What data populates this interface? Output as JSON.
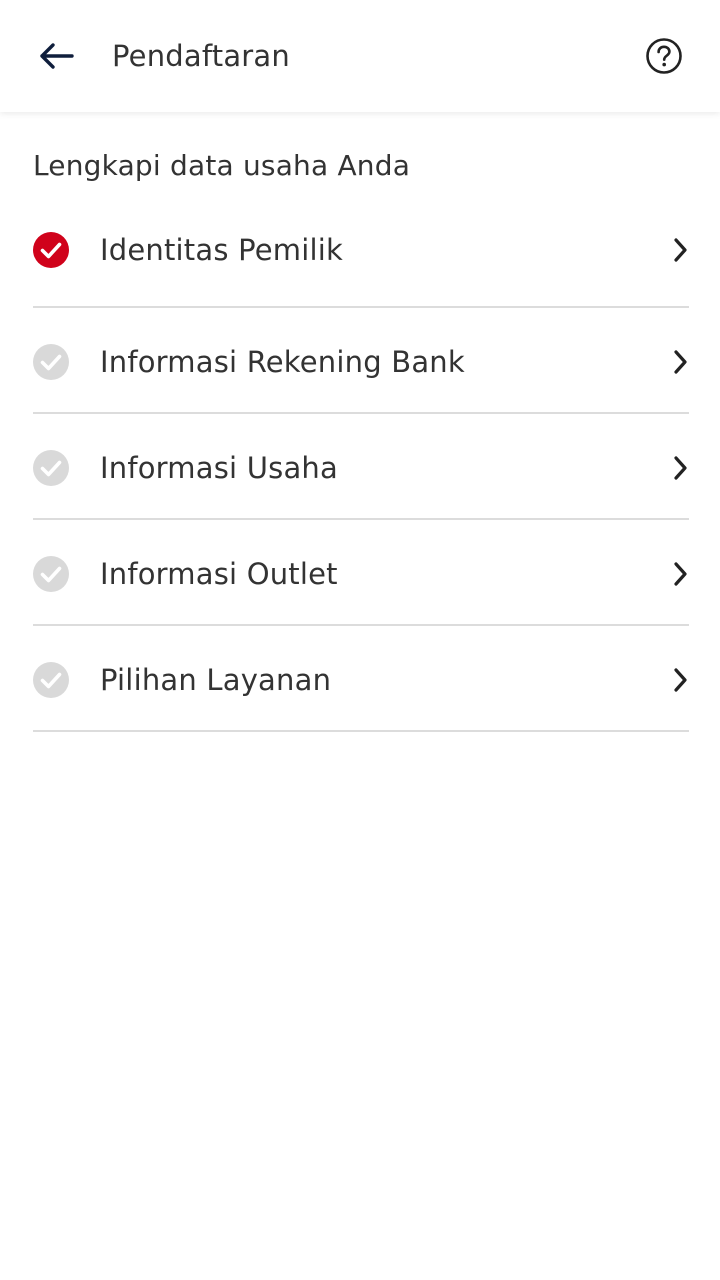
{
  "header": {
    "title": "Pendaftaran",
    "back_icon": "arrow-left-icon",
    "help_icon": "question-circle-icon"
  },
  "main": {
    "heading": "Lengkapi data usaha Anda",
    "steps": [
      {
        "label": "Identitas Pemilik",
        "completed": true
      },
      {
        "label": "Informasi Rekening Bank",
        "completed": false
      },
      {
        "label": "Informasi Usaha",
        "completed": false
      },
      {
        "label": "Informasi Outlet",
        "completed": false
      },
      {
        "label": "Pilihan Layanan",
        "completed": false
      }
    ]
  },
  "colors": {
    "completed": "#d0021b",
    "pending": "#d9d9d9",
    "text": "#333333",
    "divider": "#dcdcdc",
    "back_arrow": "#0f1e3c"
  }
}
